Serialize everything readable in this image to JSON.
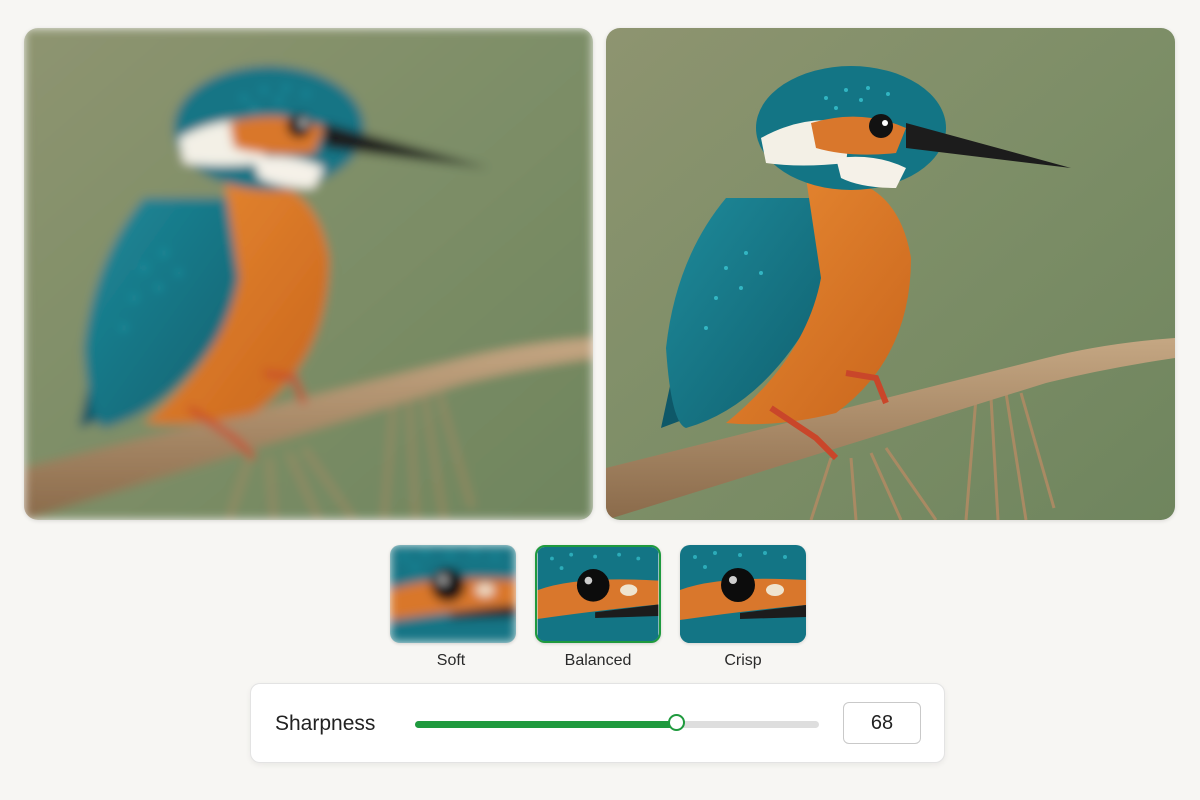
{
  "comparison": {
    "before_image": "kingfisher-blurred-photo",
    "after_image": "kingfisher-sharpened-photo"
  },
  "presets": [
    {
      "label": "Soft",
      "selected": false
    },
    {
      "label": "Balanced",
      "selected": true
    },
    {
      "label": "Crisp",
      "selected": false
    }
  ],
  "sharpness": {
    "label": "Sharpness",
    "value": "68",
    "level_fraction": 0.648
  },
  "colors": {
    "accent": "#1f9a3e",
    "background": "#f7f6f3"
  }
}
